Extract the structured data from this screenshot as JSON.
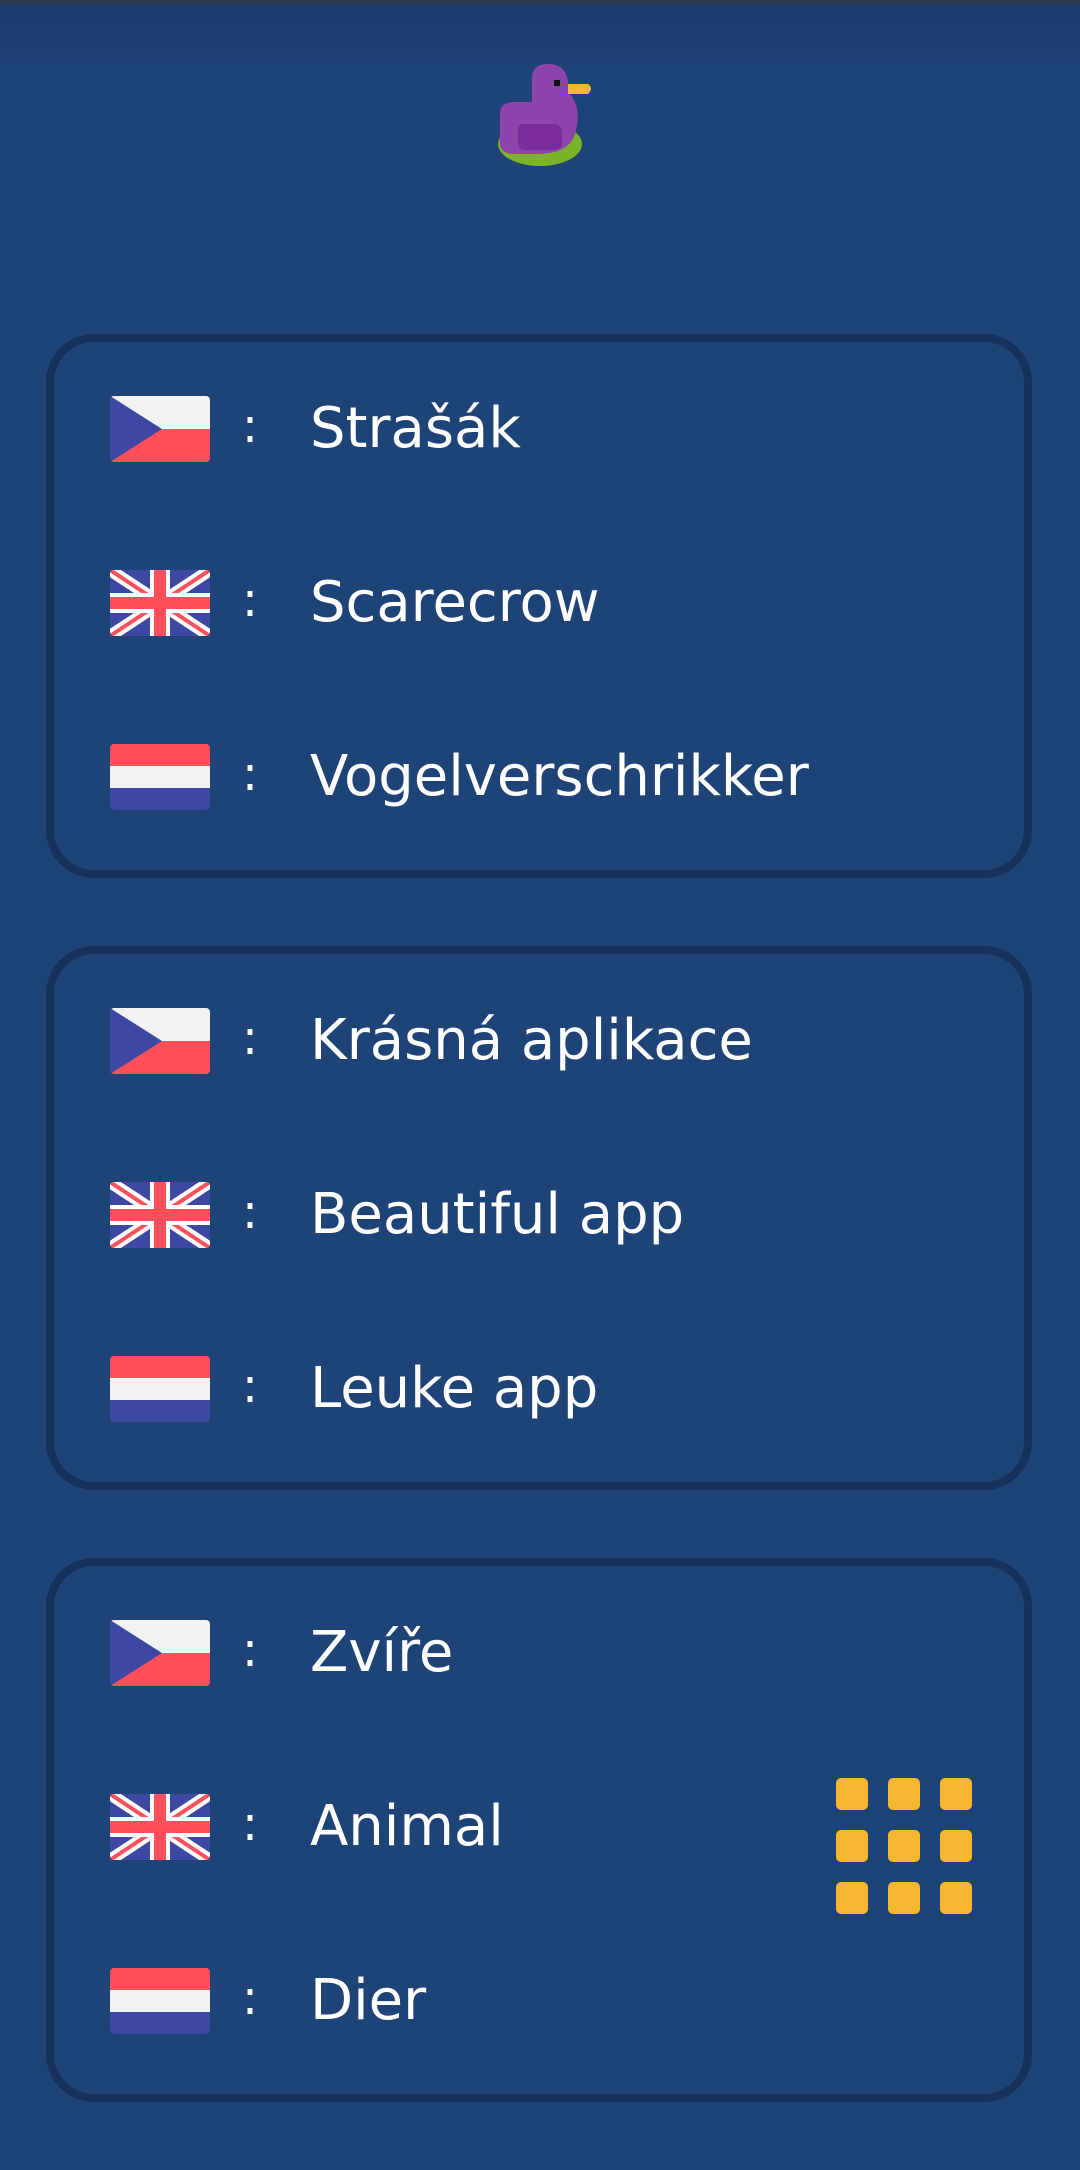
{
  "app": {
    "logo": "purple-duck-logo",
    "accent": "#f5b731",
    "background": "#1e4377",
    "card_border": "#16325a"
  },
  "separator": ":",
  "cards": [
    {
      "rows": [
        {
          "flag": "czech-flag",
          "text": "Strašák"
        },
        {
          "flag": "uk-flag",
          "text": "Scarecrow"
        },
        {
          "flag": "netherlands-flag",
          "text": "Vogelverschrikker"
        }
      ]
    },
    {
      "rows": [
        {
          "flag": "czech-flag",
          "text": "Krásná aplikace"
        },
        {
          "flag": "uk-flag",
          "text": "Beautiful app"
        },
        {
          "flag": "netherlands-flag",
          "text": "Leuke app"
        }
      ]
    },
    {
      "rows": [
        {
          "flag": "czech-flag",
          "text": "Zvíře"
        },
        {
          "flag": "uk-flag",
          "text": "Animal"
        },
        {
          "flag": "netherlands-flag",
          "text": "Dier"
        }
      ]
    }
  ],
  "menu_button": {
    "icon": "grid-menu-icon"
  }
}
